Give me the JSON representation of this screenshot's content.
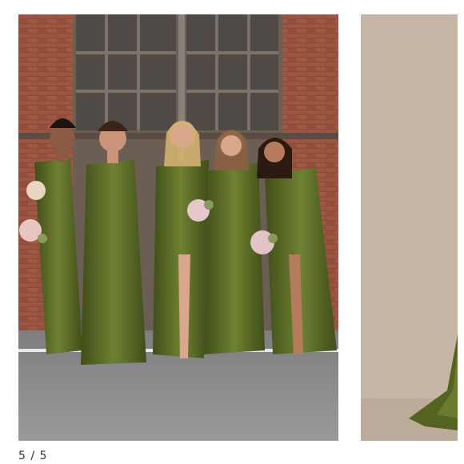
{
  "gallery": {
    "current_index": "5",
    "separator": "/",
    "total": "5",
    "main_image": {
      "alt": "",
      "colors": {
        "brick": "#8c4a38",
        "door_wood": "#6b5f55",
        "pavement": "#8d8d8f",
        "dress": "#4e5f1f",
        "dress_highlight": "#6f8132",
        "skin": "#c99478"
      }
    },
    "next_image": {
      "alt": "",
      "colors": {
        "backdrop": "#c6b6a5",
        "dress": "#556321"
      }
    }
  }
}
